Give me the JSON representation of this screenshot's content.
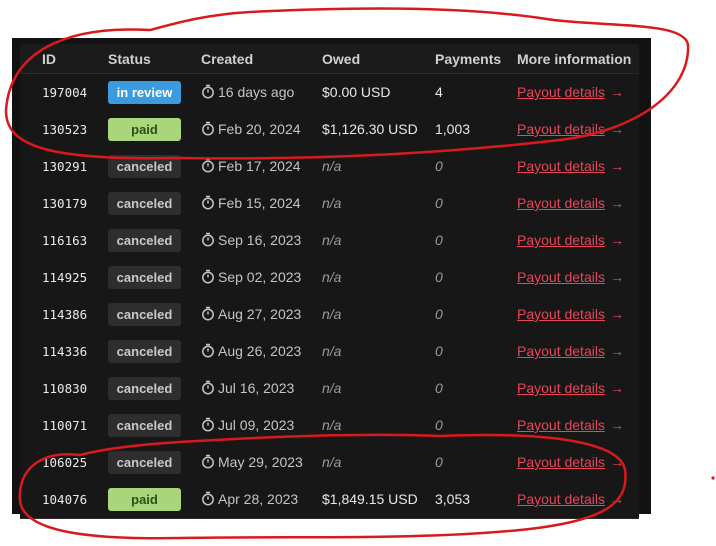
{
  "table": {
    "columns": {
      "id": "ID",
      "status": "Status",
      "created": "Created",
      "owed": "Owed",
      "payments": "Payments",
      "more": "More information"
    },
    "link_label": "Payout details",
    "arrow": "→",
    "rows": [
      {
        "id": "197004",
        "status": "in review",
        "status_kind": "review",
        "created": "16 days ago",
        "owed": "$0.00 USD",
        "payments": "4"
      },
      {
        "id": "130523",
        "status": "paid",
        "status_kind": "paid",
        "created": "Feb 20, 2024",
        "owed": "$1,126.30 USD",
        "payments": "1,003"
      },
      {
        "id": "130291",
        "status": "canceled",
        "status_kind": "cancel",
        "created": "Feb 17, 2024",
        "owed": "n/a",
        "payments": "0"
      },
      {
        "id": "130179",
        "status": "canceled",
        "status_kind": "cancel",
        "created": "Feb 15, 2024",
        "owed": "n/a",
        "payments": "0"
      },
      {
        "id": "116163",
        "status": "canceled",
        "status_kind": "cancel",
        "created": "Sep 16, 2023",
        "owed": "n/a",
        "payments": "0"
      },
      {
        "id": "114925",
        "status": "canceled",
        "status_kind": "cancel",
        "created": "Sep 02, 2023",
        "owed": "n/a",
        "payments": "0"
      },
      {
        "id": "114386",
        "status": "canceled",
        "status_kind": "cancel",
        "created": "Aug 27, 2023",
        "owed": "n/a",
        "payments": "0"
      },
      {
        "id": "114336",
        "status": "canceled",
        "status_kind": "cancel",
        "created": "Aug 26, 2023",
        "owed": "n/a",
        "payments": "0"
      },
      {
        "id": "110830",
        "status": "canceled",
        "status_kind": "cancel",
        "created": "Jul 16, 2023",
        "owed": "n/a",
        "payments": "0"
      },
      {
        "id": "110071",
        "status": "canceled",
        "status_kind": "cancel",
        "created": "Jul 09, 2023",
        "owed": "n/a",
        "payments": "0"
      },
      {
        "id": "106025",
        "status": "canceled",
        "status_kind": "cancel",
        "created": "May 29, 2023",
        "owed": "n/a",
        "payments": "0"
      },
      {
        "id": "104076",
        "status": "paid",
        "status_kind": "paid",
        "created": "Apr 28, 2023",
        "owed": "$1,849.15 USD",
        "payments": "3,053"
      }
    ]
  },
  "colors": {
    "annotation": "#d8191e",
    "link": "#e8445a",
    "badge_review": "#3a9be0",
    "badge_paid": "#a9d67a",
    "badge_canceled": "#2e2e2e"
  },
  "icons": {
    "created": "stopwatch-icon",
    "link_arrow": "arrow-right-icon"
  }
}
